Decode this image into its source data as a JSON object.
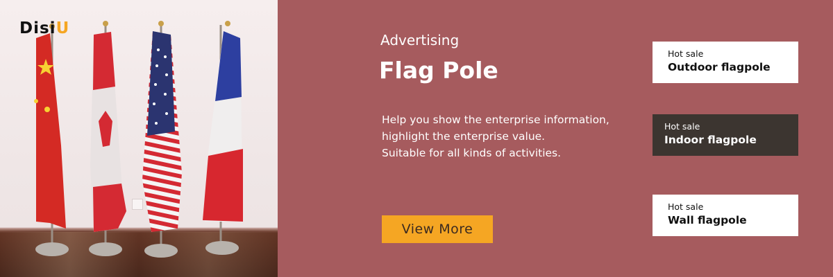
{
  "brand": {
    "logo_main": "Disi",
    "logo_accent": "U"
  },
  "colors": {
    "panel": "#a65b5e",
    "accent": "#f5a623",
    "dark_card": "#3c3530",
    "light_card": "#ffffff"
  },
  "hero": {
    "eyebrow": "Advertising",
    "title": "Flag Pole",
    "desc_line1": "Help you show the enterprise information, highlight the enterprise value.",
    "desc_line2": "Suitable for all kinds of activities.",
    "cta_label": "View  More"
  },
  "cards": [
    {
      "tag": "Hot sale",
      "name": "Outdoor flagpole"
    },
    {
      "tag": "Hot sale",
      "name": "Indoor flagpole"
    },
    {
      "tag": "Hot sale",
      "name": "Wall flagpole"
    }
  ],
  "photo": {
    "flags": [
      "china-flag-icon",
      "canada-flag-icon",
      "usa-flag-icon",
      "france-flag-icon"
    ]
  }
}
